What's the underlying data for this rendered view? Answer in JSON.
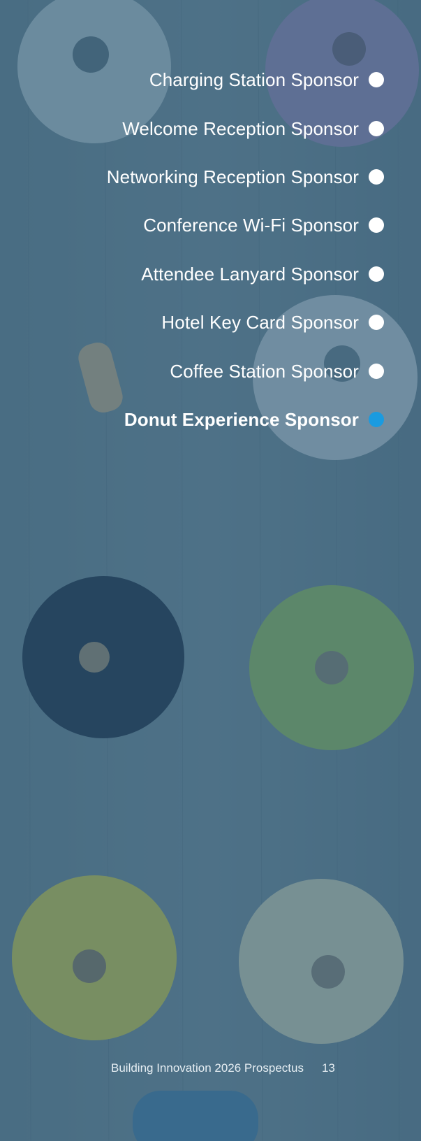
{
  "menu": {
    "items": [
      {
        "label": "Charging Station Sponsor",
        "active": false
      },
      {
        "label": "Welcome Reception Sponsor",
        "active": false
      },
      {
        "label": "Networking Reception Sponsor",
        "active": false
      },
      {
        "label": "Conference Wi-Fi Sponsor",
        "active": false
      },
      {
        "label": "Attendee Lanyard Sponsor",
        "active": false
      },
      {
        "label": "Hotel Key Card Sponsor",
        "active": false
      },
      {
        "label": "Coffee Station Sponsor",
        "active": false
      },
      {
        "label": "Donut Experience Sponsor",
        "active": true
      }
    ]
  },
  "footer": {
    "title": "Building Innovation 2026 Prospectus",
    "page_number": "13"
  },
  "colors": {
    "accent": "#1a9be0",
    "overlay": "#2c526a"
  }
}
